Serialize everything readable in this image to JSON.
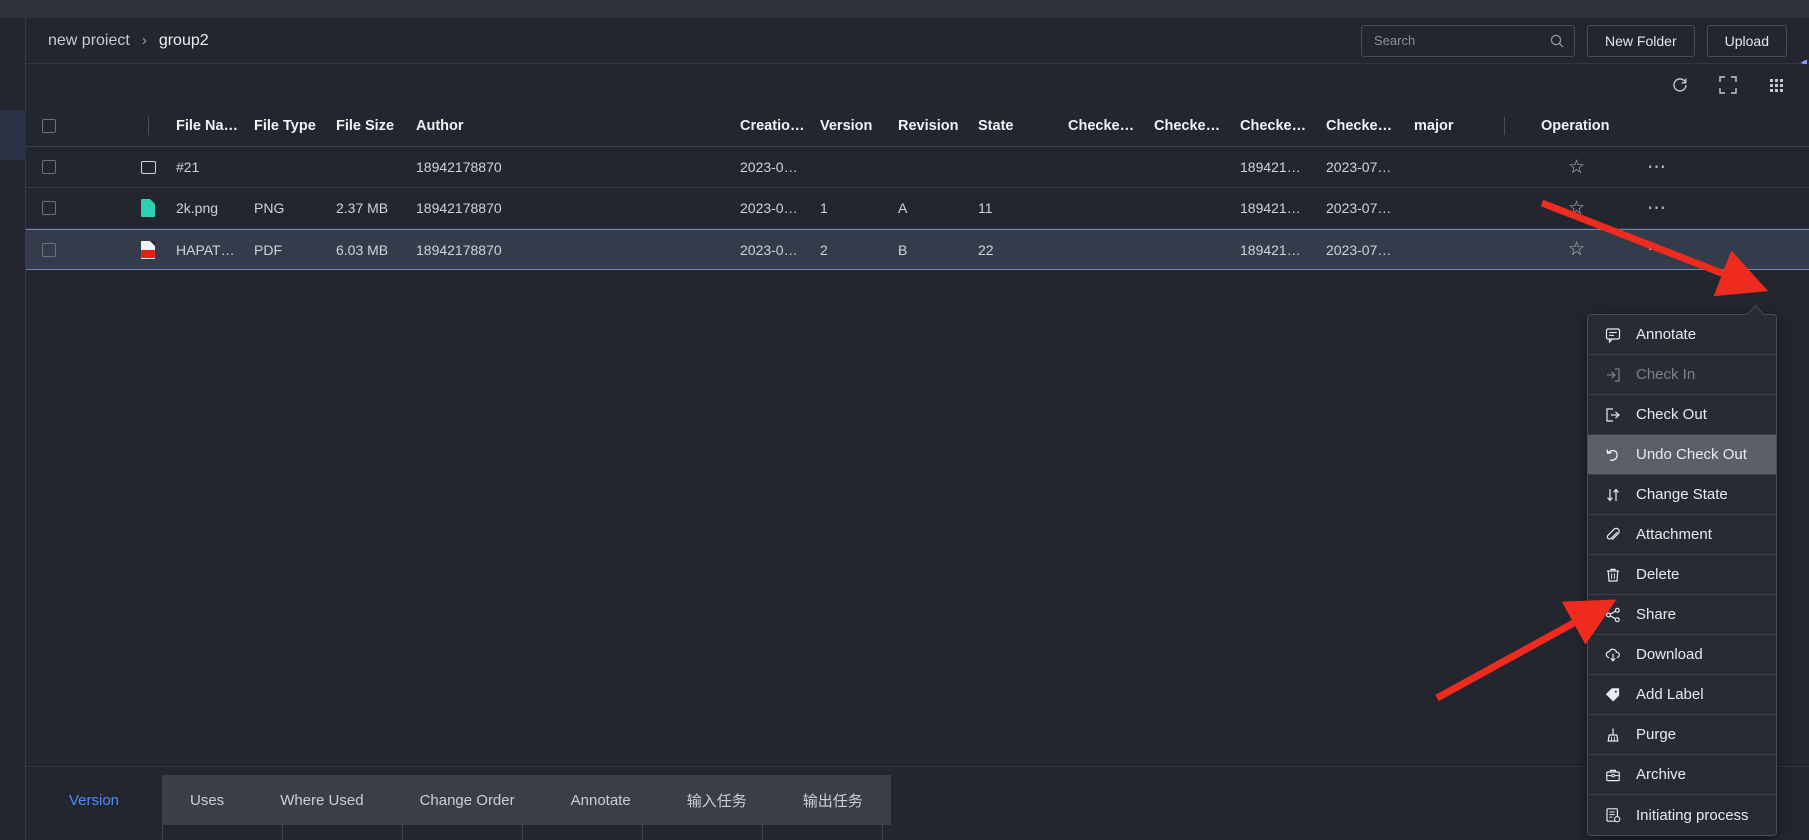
{
  "breadcrumb": {
    "root": "new proiect",
    "separator": "›",
    "current": "group2"
  },
  "header": {
    "search_placeholder": "Search",
    "search_value": "",
    "new_folder_label": "New Folder",
    "upload_label": "Upload"
  },
  "toolbar": {
    "refresh_title": "refresh",
    "fullscreen_title": "fullscreen",
    "grid_title": "grid view"
  },
  "table": {
    "headers": {
      "file_name": "File Na…",
      "file_type": "File Type",
      "file_size": "File Size",
      "author": "Author",
      "creation": "Creatio…",
      "version": "Version",
      "revision": "Revision",
      "state": "State",
      "checked1": "Checke…",
      "checked2": "Checke…",
      "checked3": "Checke…",
      "checked4": "Checke…",
      "major": "major",
      "operation": "Operation"
    },
    "rows": [
      {
        "icon": "folder-icon",
        "file_name": "#21",
        "file_type": "",
        "file_size": "",
        "author": "18942178870",
        "creation": "2023-0…",
        "version": "",
        "revision": "",
        "state": "",
        "checked1": "",
        "checked2": "",
        "checked3": "189421…",
        "checked4": "2023-07…",
        "major": "",
        "selected": false
      },
      {
        "icon": "png-file-icon",
        "file_name": "2k.png",
        "file_type": "PNG",
        "file_size": "2.37 MB",
        "author": "18942178870",
        "creation": "2023-0…",
        "version": "1",
        "revision": "A",
        "state": "11",
        "checked1": "",
        "checked2": "",
        "checked3": "189421…",
        "checked4": "2023-07…",
        "major": "",
        "selected": false
      },
      {
        "icon": "pdf-file-icon",
        "file_name": "HAPAT…",
        "file_type": "PDF",
        "file_size": "6.03 MB",
        "author": "18942178870",
        "creation": "2023-0…",
        "version": "2",
        "revision": "B",
        "state": "22",
        "checked1": "",
        "checked2": "",
        "checked3": "189421…",
        "checked4": "2023-07…",
        "major": "",
        "selected": true
      }
    ]
  },
  "context_menu": {
    "items": [
      {
        "label": "Annotate",
        "icon": "annotate-icon",
        "disabled": false,
        "active": false
      },
      {
        "label": "Check In",
        "icon": "check-in-icon",
        "disabled": true,
        "active": false
      },
      {
        "label": "Check Out",
        "icon": "check-out-icon",
        "disabled": false,
        "active": false
      },
      {
        "label": "Undo Check Out",
        "icon": "undo-icon",
        "disabled": false,
        "active": true
      },
      {
        "label": "Change State",
        "icon": "change-state-icon",
        "disabled": false,
        "active": false
      },
      {
        "label": "Attachment",
        "icon": "paperclip-icon",
        "disabled": false,
        "active": false
      },
      {
        "label": "Delete",
        "icon": "trash-icon",
        "disabled": false,
        "active": false
      },
      {
        "label": "Share",
        "icon": "share-icon",
        "disabled": false,
        "active": false
      },
      {
        "label": "Download",
        "icon": "download-icon",
        "disabled": false,
        "active": false
      },
      {
        "label": "Add Label",
        "icon": "label-icon",
        "disabled": false,
        "active": false
      },
      {
        "label": "Purge",
        "icon": "broom-icon",
        "disabled": false,
        "active": false
      },
      {
        "label": "Archive",
        "icon": "archive-icon",
        "disabled": false,
        "active": false
      },
      {
        "label": "Initiating process",
        "icon": "process-icon",
        "disabled": false,
        "active": false
      }
    ]
  },
  "bottom_tabs": {
    "active": "Version",
    "items": [
      "Uses",
      "Where Used",
      "Change Order",
      "Annotate",
      "输入任务",
      "输出任务"
    ]
  },
  "colors": {
    "accent_blue": "#4b8dff",
    "selection_bg": "#343c4c",
    "annotation_red": "#ee2b1e",
    "png_green": "#2ecfb4",
    "pdf_red": "#e2231a"
  }
}
